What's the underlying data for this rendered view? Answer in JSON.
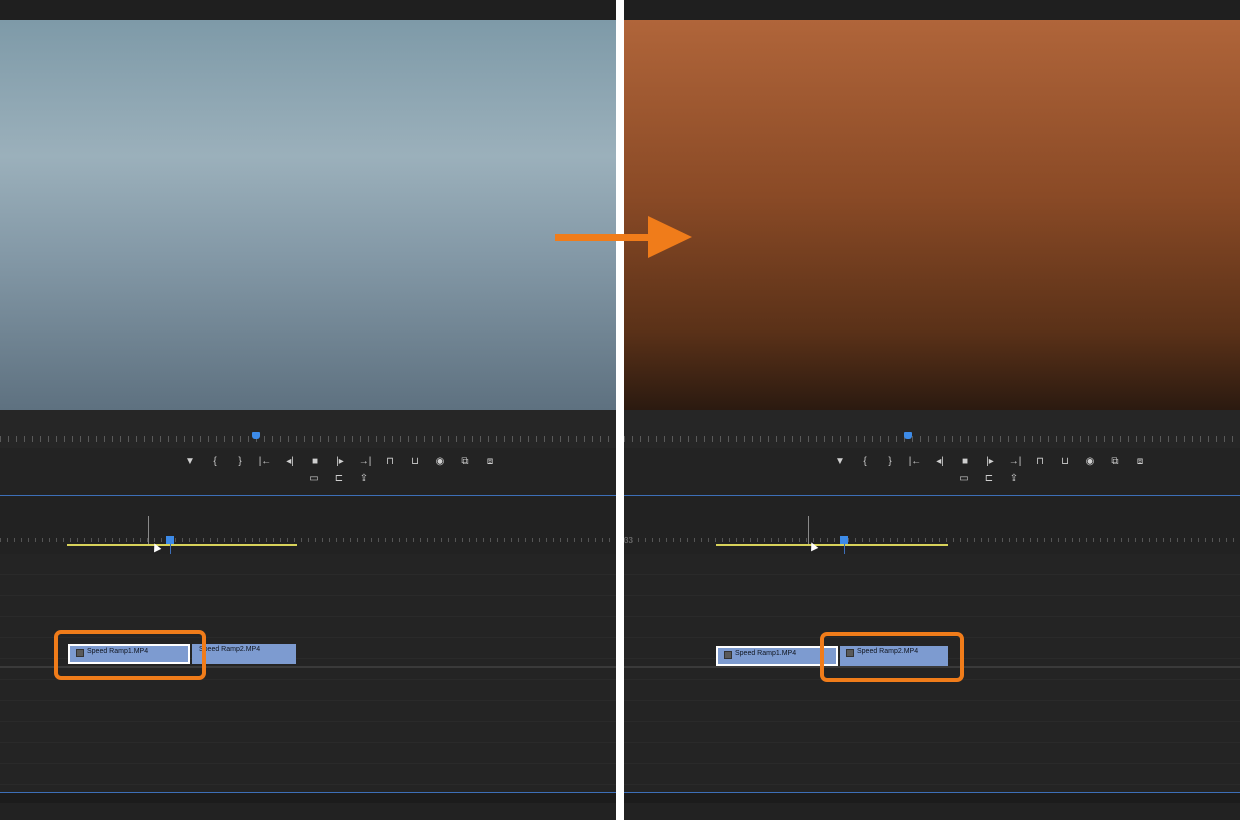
{
  "before_panel": {
    "clips": [
      {
        "label": "Speed Ramp1.MP4",
        "selected": true
      },
      {
        "label": "Speed Ramp2.MP4",
        "selected": false
      }
    ],
    "highlighted_clip": "Speed Ramp1.MP4"
  },
  "after_panel": {
    "timecode_fragment": "33",
    "clips": [
      {
        "label": "Speed Ramp1.MP4",
        "selected": true
      },
      {
        "label": "Speed Ramp2.MP4",
        "selected": false
      }
    ],
    "highlighted_clip": "Speed Ramp2.MP4"
  },
  "transport_controls": {
    "row1": [
      "marker-icon",
      "mark-in-icon",
      "mark-out-icon",
      "go-to-in-icon",
      "step-back-icon",
      "stop-icon",
      "step-forward-icon",
      "go-to-out-icon",
      "lift-icon",
      "extract-icon",
      "export-frame-icon",
      "insert-icon",
      "overwrite-icon"
    ],
    "row2": [
      "safe-margins-icon",
      "trim-icon",
      "export-icon"
    ],
    "glyphs": {
      "marker-icon": "▼",
      "mark-in-icon": "{",
      "mark-out-icon": "}",
      "go-to-in-icon": "|←",
      "step-back-icon": "◂|",
      "stop-icon": "■",
      "step-forward-icon": "|▸",
      "go-to-out-icon": "→|",
      "lift-icon": "⊓",
      "extract-icon": "⊔",
      "export-frame-icon": "◉",
      "insert-icon": "⧉",
      "overwrite-icon": "⧈",
      "safe-margins-icon": "▭",
      "trim-icon": "⊏",
      "export-icon": "⇪"
    }
  },
  "colors": {
    "highlight": "#f07c1a",
    "clip": "#7d9bd0",
    "playhead": "#3d8be8",
    "work_area": "#d8d25a"
  }
}
